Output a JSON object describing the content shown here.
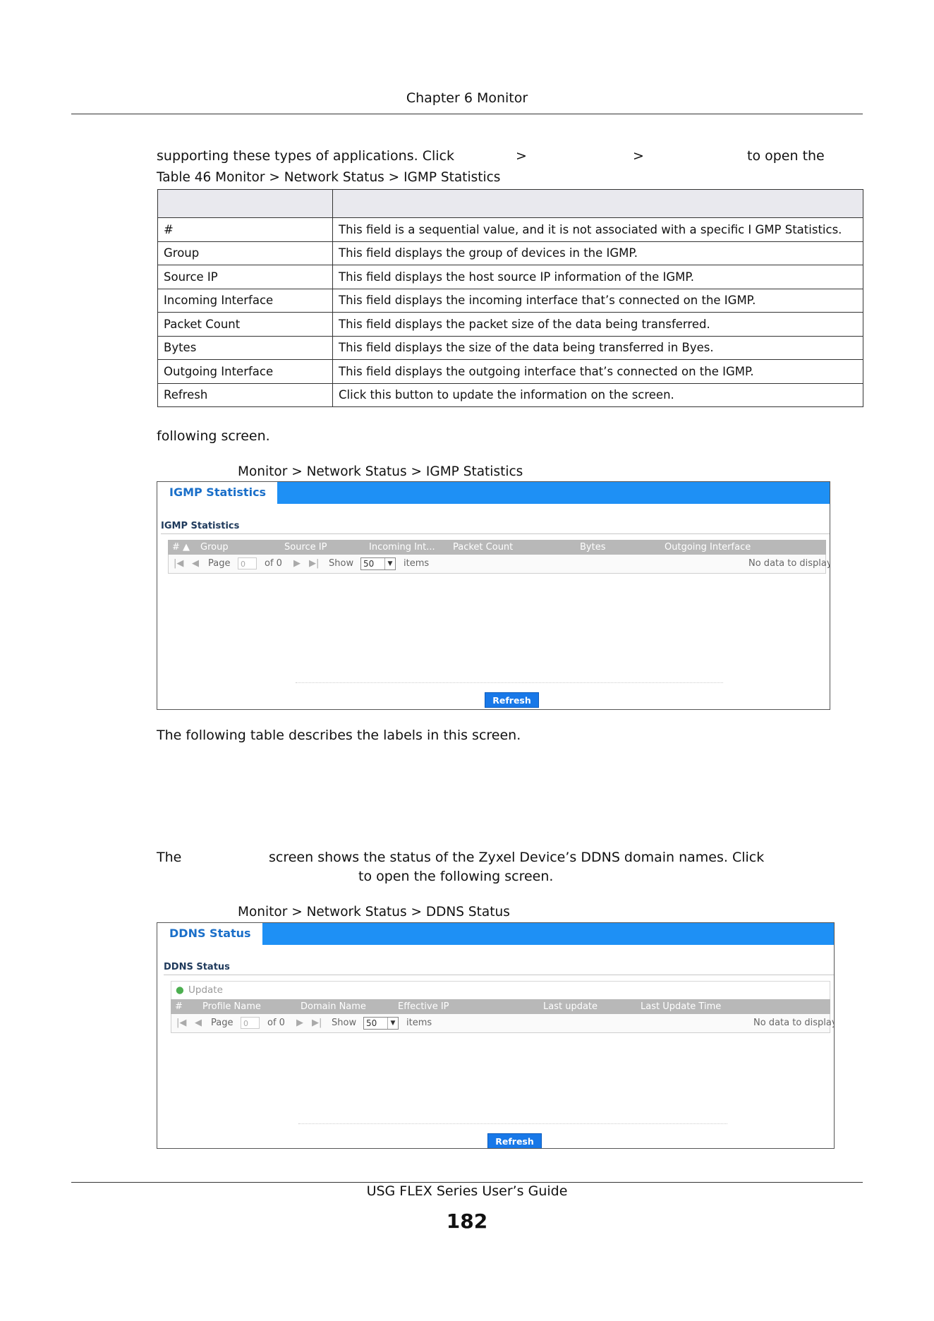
{
  "header": {
    "chapter": "Chapter 6 Monitor"
  },
  "intro": {
    "line1": "supporting these types of applications. Click",
    "gt1": ">",
    "gt2": ">",
    "open_text": "to open the",
    "following": "following screen."
  },
  "table46": {
    "caption": "Table 46   Monitor > Network Status > IGMP Statistics",
    "rows": [
      {
        "label": "#",
        "desc": "This field is a sequential value, and it is not associated with a specific I GMP Statistics."
      },
      {
        "label": "Group",
        "desc": "This field displays the group of devices in the IGMP."
      },
      {
        "label": "Source IP",
        "desc": "This field displays the host source IP information of the IGMP."
      },
      {
        "label": "Incoming Interface",
        "desc": "This field displays the incoming interface that’s connected on the IGMP."
      },
      {
        "label": "Packet Count",
        "desc": "This field displays the packet size of the data being transferred."
      },
      {
        "label": "Bytes",
        "desc": "This field displays the size of the data being transferred in Byes."
      },
      {
        "label": "Outgoing Interface",
        "desc": "This field displays the outgoing interface that’s connected on the IGMP."
      },
      {
        "label": "Refresh",
        "desc": "Click this button to update the information on the screen."
      }
    ]
  },
  "igmp_figure": {
    "caption": "Monitor > Network Status > IGMP Statistics",
    "tab": "IGMP Statistics",
    "section": "IGMP Statistics",
    "columns": [
      "# ▲",
      "Group",
      "Source IP",
      "Incoming Int...",
      "Packet Count",
      "Bytes",
      "Outgoing Interface"
    ],
    "pager": {
      "page_label": "Page",
      "page_value": "0",
      "of_label": "of 0",
      "show_label": "Show",
      "show_value": "50",
      "items_label": "items",
      "empty": "No data to display"
    },
    "refresh": "Refresh"
  },
  "after_igmp": "The following table describes the labels in this screen.",
  "ddns_intro": {
    "the": "The",
    "line1": "screen shows the status of the Zyxel Device’s DDNS domain names. Click",
    "line2": "to open the following screen."
  },
  "ddns_figure": {
    "caption": "Monitor > Network Status > DDNS Status",
    "tab": "DDNS Status",
    "section": "DDNS Status",
    "update": "Update",
    "columns": [
      "#",
      "Profile Name",
      "Domain Name",
      "Effective IP",
      "Last update",
      "Last Update Time"
    ],
    "pager": {
      "page_label": "Page",
      "page_value": "0",
      "of_label": "of 0",
      "show_label": "Show",
      "show_value": "50",
      "items_label": "items",
      "empty": "No data to display"
    },
    "refresh": "Refresh"
  },
  "footer": {
    "guide": "USG FLEX Series User’s Guide",
    "page_number": "182"
  },
  "colors": {
    "accent": "#1e90f5",
    "button": "#1878e8",
    "grid_header": "#b8b8b8"
  }
}
